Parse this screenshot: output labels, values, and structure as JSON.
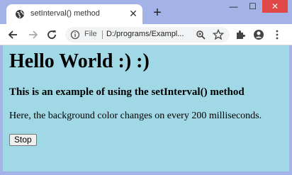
{
  "browser": {
    "tab": {
      "title": "setInterval() method",
      "favicon_icon": "globe-icon",
      "close_label": "✕"
    },
    "new_tab_label": "+",
    "window_controls": {
      "minimize": "—",
      "maximize": "☐",
      "close": "✕"
    },
    "toolbar": {
      "back_icon": "arrow-left-icon",
      "forward_icon": "arrow-right-icon",
      "reload_icon": "reload-icon",
      "omnibox": {
        "scheme_label": "File",
        "url": "D:/programs/Exampl..."
      },
      "extensions_icon": "puzzle-icon",
      "profile_icon": "account-icon",
      "menu_icon": "kebab-menu-icon"
    },
    "colors": {
      "frame": "#a3b3e8",
      "page_background": "#a0d8e6",
      "close_button": "#e04848"
    }
  },
  "page": {
    "heading": "Hello World :) :)",
    "subheading": "This is an example of using the setInterval() method",
    "description": "Here, the background color changes on every 200 milliseconds.",
    "stop_button_label": "Stop"
  }
}
